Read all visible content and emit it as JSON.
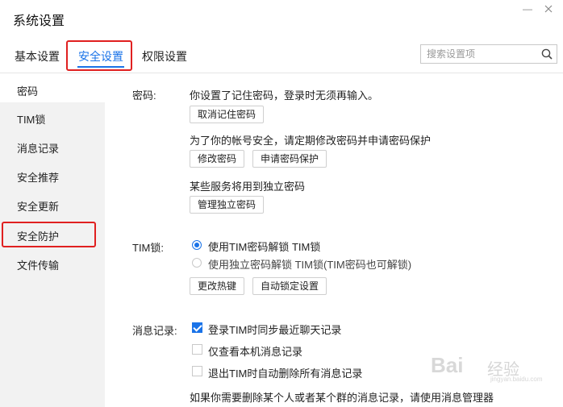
{
  "window": {
    "title": "系统设置",
    "minimize_symbol": "—"
  },
  "tabs": [
    {
      "label": "基本设置",
      "active": false
    },
    {
      "label": "安全设置",
      "active": true
    },
    {
      "label": "权限设置",
      "active": false
    }
  ],
  "search": {
    "placeholder": "搜索设置项",
    "value": ""
  },
  "sidebar": {
    "items": [
      {
        "label": "密码",
        "selected": true
      },
      {
        "label": "TIM锁"
      },
      {
        "label": "消息记录"
      },
      {
        "label": "安全推荐"
      },
      {
        "label": "安全更新"
      },
      {
        "label": "安全防护",
        "highlighted": true
      },
      {
        "label": "文件传输"
      }
    ]
  },
  "password": {
    "label": "密码:",
    "remembered_text": "你设置了记住密码，登录时无须再输入。",
    "cancel_remember_button": "取消记住密码",
    "security_tip": "为了你的帐号安全，请定期修改密码并申请密码保护",
    "change_password_button": "修改密码",
    "apply_protection_button": "申请密码保护",
    "independent_tip": "某些服务将用到独立密码",
    "manage_independent_button": "管理独立密码"
  },
  "tim_lock": {
    "label": "TIM锁:",
    "options": [
      {
        "label": "使用TIM密码解锁 TIM锁",
        "selected": true
      },
      {
        "label": "使用独立密码解锁 TIM锁(TIM密码也可解锁)",
        "selected": false
      }
    ],
    "change_hotkey_button": "更改热键",
    "auto_lock_button": "自动锁定设置"
  },
  "message_record": {
    "label": "消息记录:",
    "options": [
      {
        "label": "登录TIM时同步最近聊天记录",
        "checked": true
      },
      {
        "label": "仅查看本机消息记录",
        "checked": false
      },
      {
        "label": "退出TIM时自动删除所有消息记录",
        "checked": false
      }
    ],
    "manager_tip": "如果你需要删除某个人或者某个群的消息记录，请使用消息管理器"
  },
  "watermark": {
    "brand": "Bai",
    "cn": "经验",
    "url": "jingyan.baidu.com"
  },
  "colors": {
    "accent": "#1a73e8",
    "highlight_border": "#e02020",
    "sidebar_bg": "#f2f2f2"
  }
}
